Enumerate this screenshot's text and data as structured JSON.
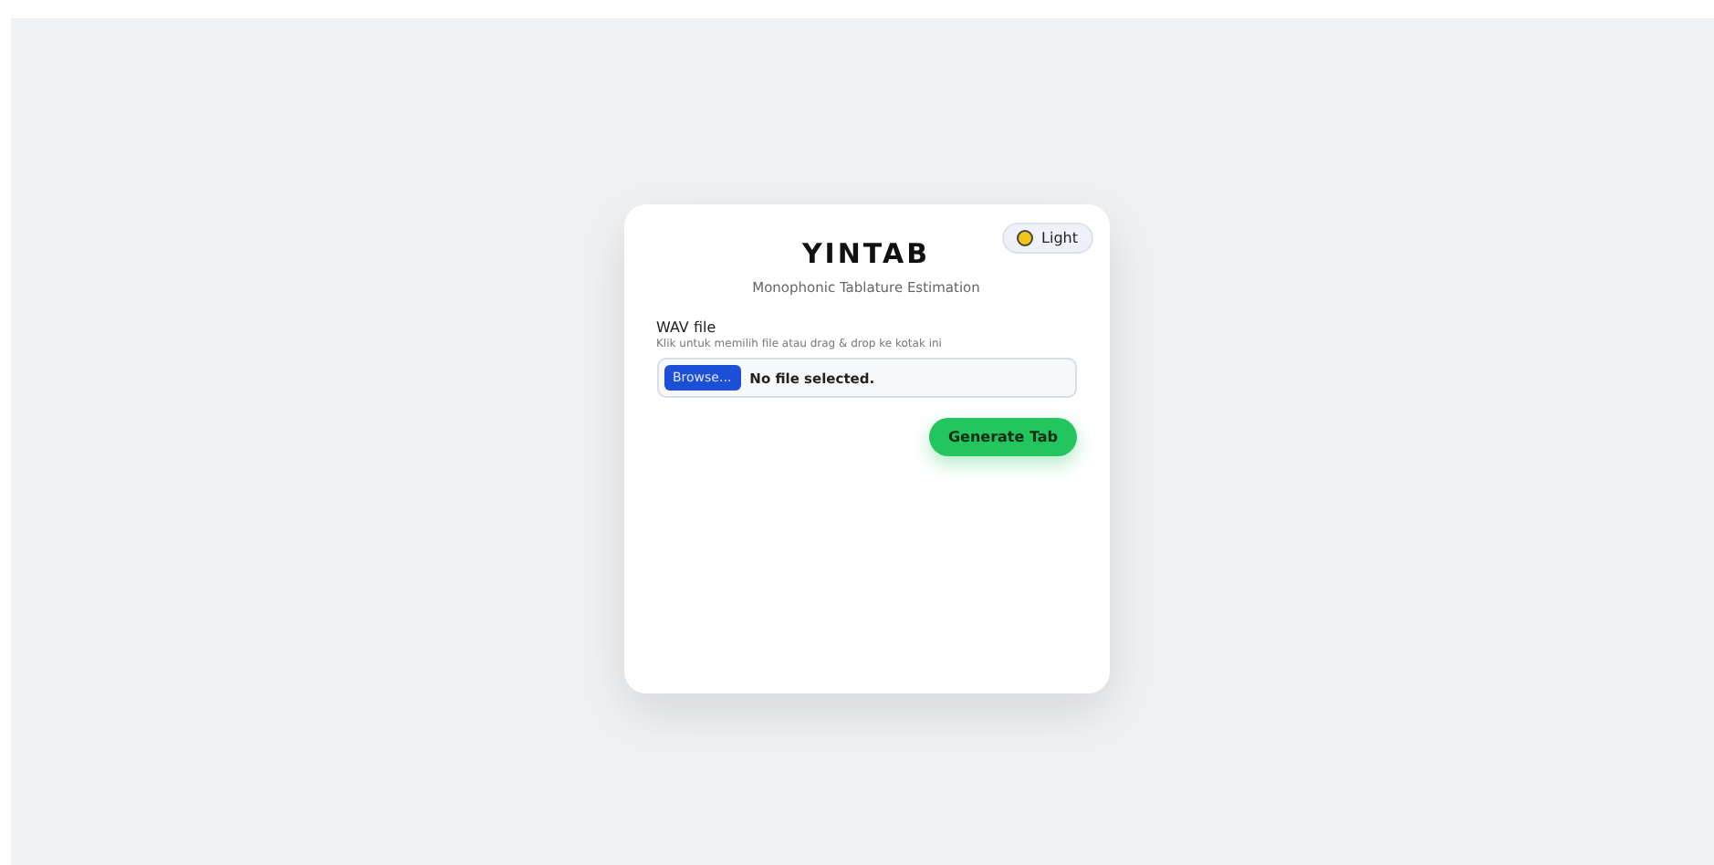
{
  "theme_toggle": {
    "label": "Light"
  },
  "header": {
    "title": "YINTAB",
    "subtitle": "Monophonic Tablature Estimation"
  },
  "file_input": {
    "label": "WAV file",
    "hint": "Klik untuk memilih file atau drag & drop ke kotak ini",
    "browse_button": "Browse...",
    "status": "No file selected."
  },
  "buttons": [
    {
      "label": "Generate Tab"
    }
  ]
}
